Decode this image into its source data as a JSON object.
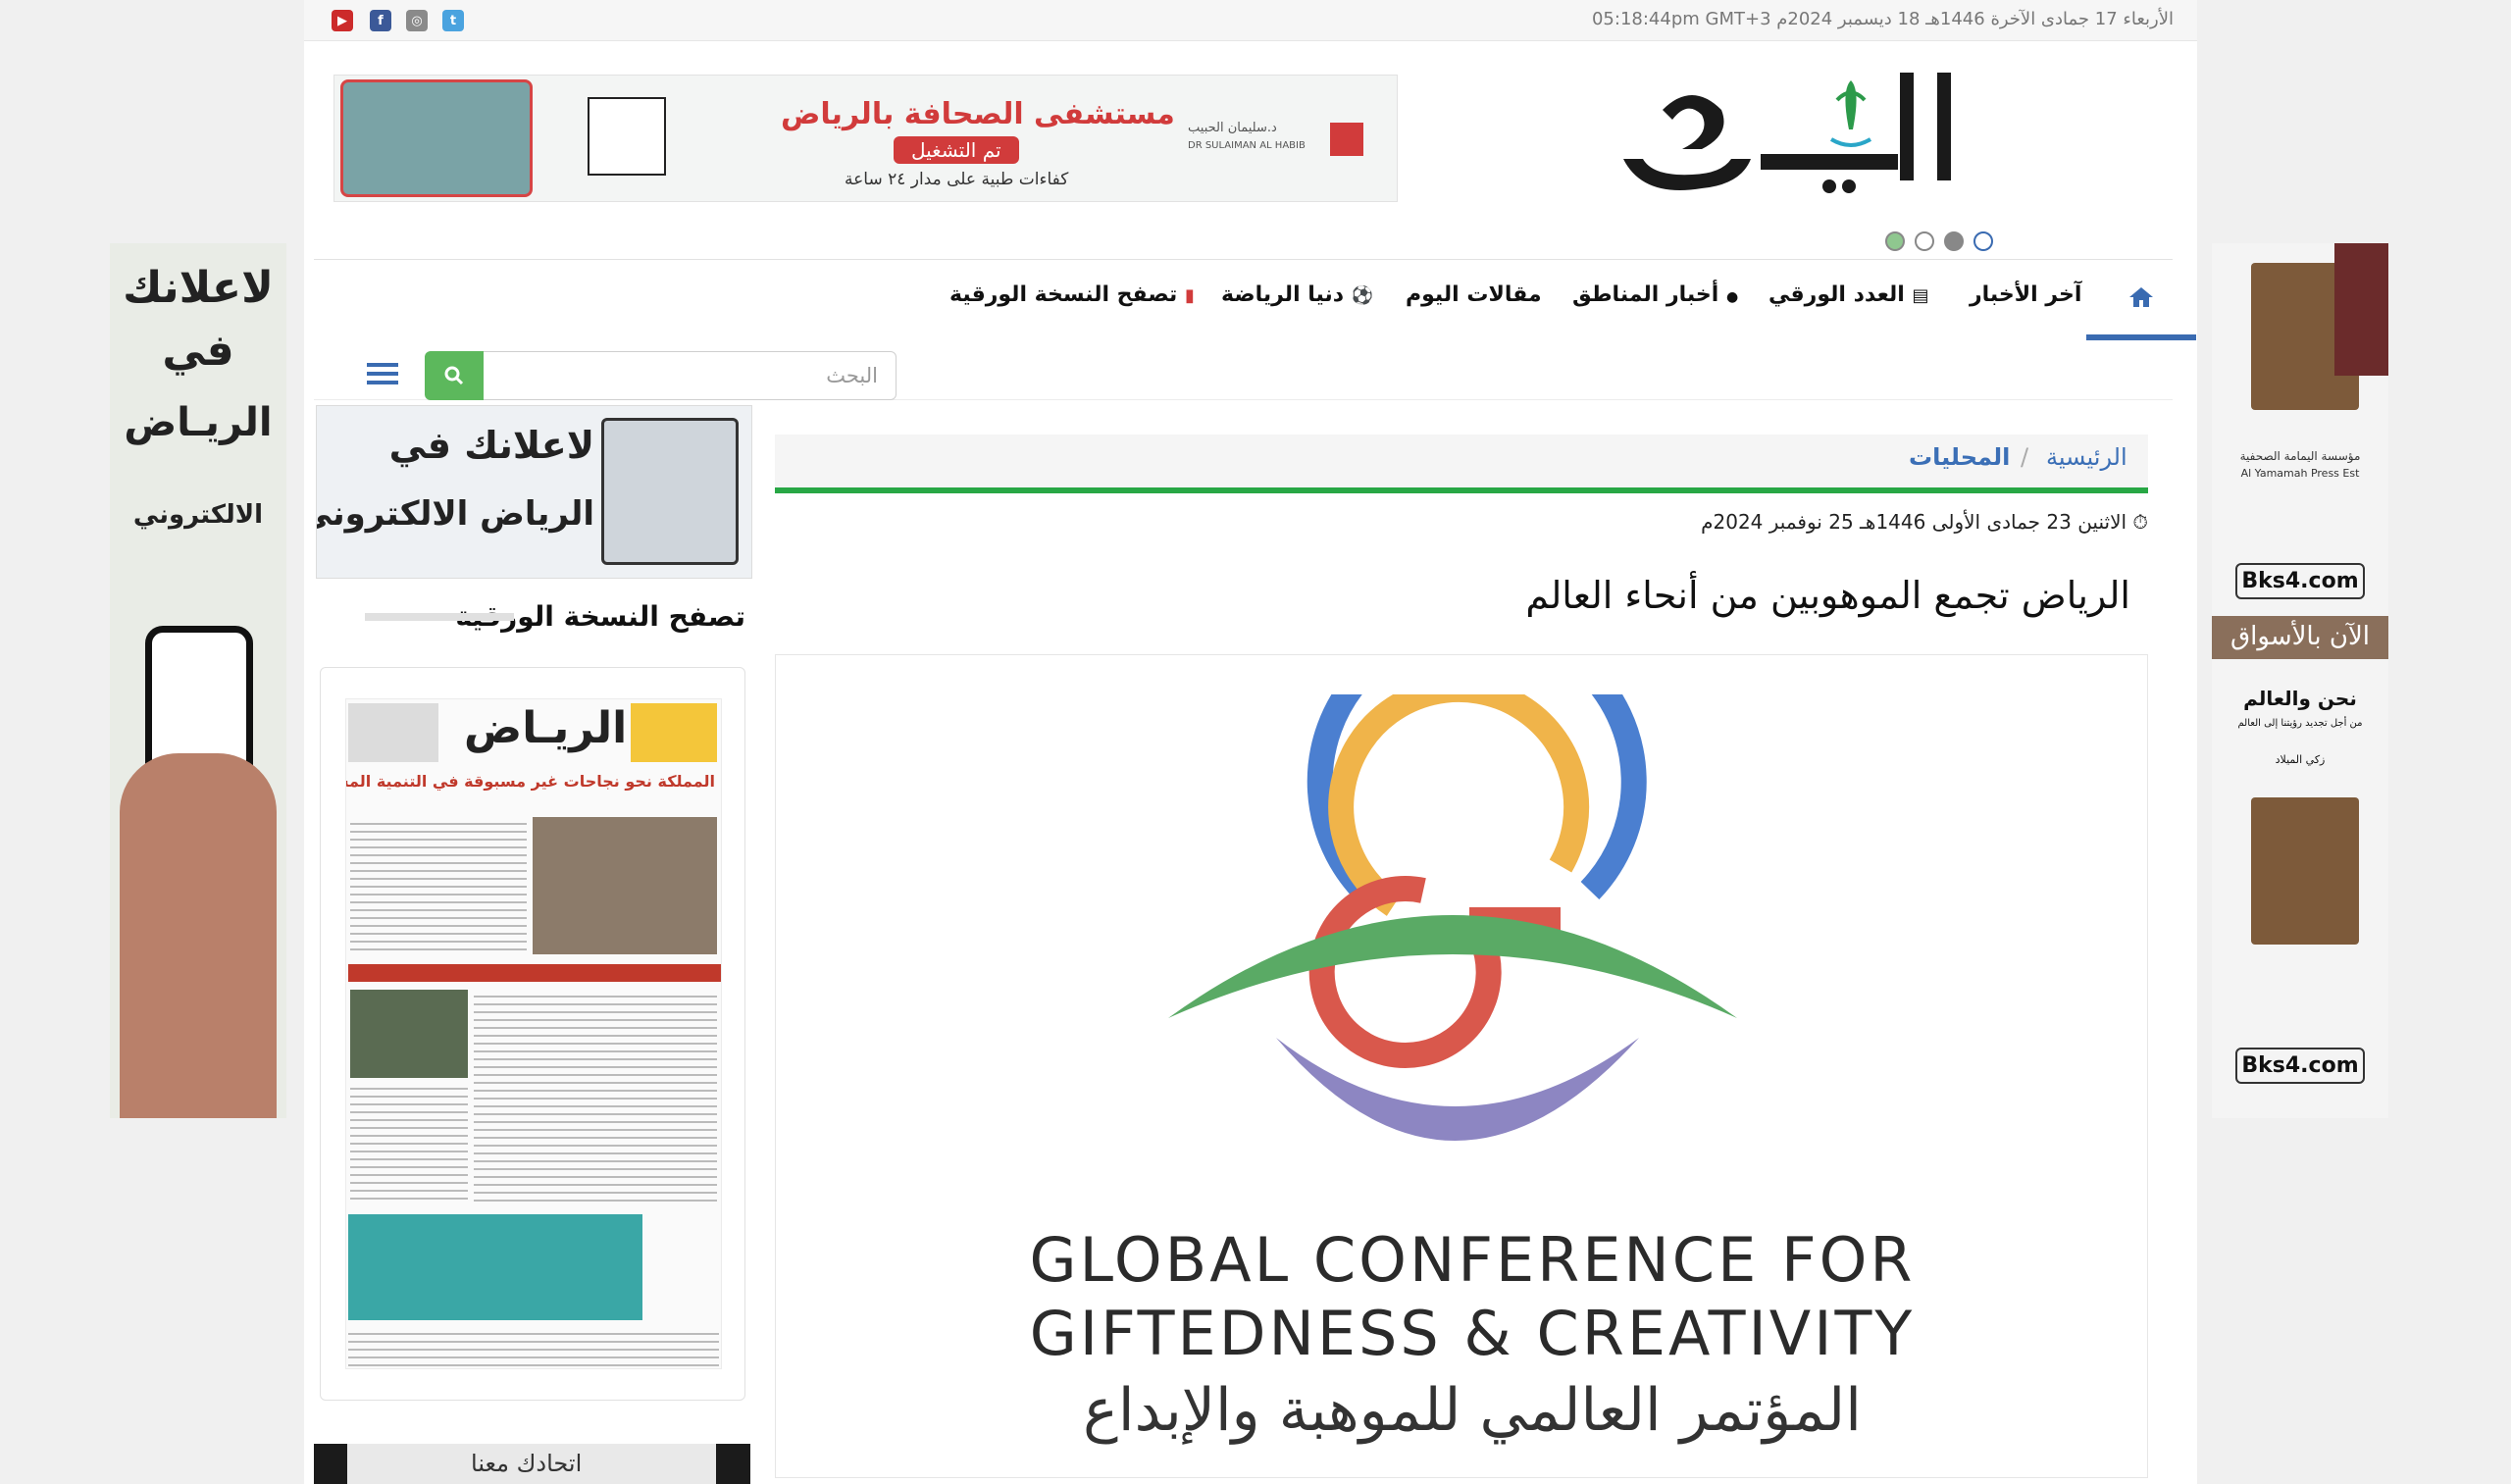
{
  "topbar": {
    "date_text": "الأربعاء 17 جمادى الآخرة 1446هـ 18 ديسمبر 2024م 05:18:44pm GMT+3",
    "social": {
      "youtube": "▶",
      "facebook": "f",
      "instagram": "◎",
      "twitter": "t"
    }
  },
  "logo": {
    "text": "الريـاض"
  },
  "header_ad": {
    "headline": "مستشفى الصحافة بالرياض",
    "badge": "تم التشغيل",
    "sub": "كفاءات طبية على مدار ٢٤ ساعة",
    "brand_ar": "د.سليمان الحبيب",
    "brand_en": "DR SULAIMAN AL HABIB"
  },
  "colors": {
    "accent_blue": "#3a6bb1",
    "green": "#28a745",
    "search_green": "#5cb85c",
    "link_blue": "#3b6fb6"
  },
  "nav": {
    "items": [
      {
        "label": "آخر الأخبار",
        "icon": ""
      },
      {
        "label": "العدد الورقي",
        "icon": "▤"
      },
      {
        "label": "أخبار المناطق",
        "icon": "●"
      },
      {
        "label": "مقالات اليوم",
        "icon": ""
      },
      {
        "label": "دنيا الرياضة",
        "icon": "⚽"
      },
      {
        "label": "تصفح النسخة الورقية",
        "icon": "▮"
      }
    ]
  },
  "search": {
    "placeholder": "البحث"
  },
  "breadcrumb": {
    "home": "الرئيسية",
    "sep": "/",
    "current": "المحليات"
  },
  "article": {
    "date": "الاثنين 23 جمادى الأولى 1446هـ 25 نوفمبر 2024م",
    "headline": "الرياض تجمع الموهوبين من أنحاء العالم",
    "hero": {
      "line1": "GLOBAL CONFERENCE FOR",
      "line2": "GIFTEDNESS & CREATIVITY",
      "line3": "المؤتمر العالمي للموهبة والإبداع"
    }
  },
  "sidebar": {
    "ad_text_1": "لاعلانك في",
    "ad_text_2": "الرياض الالكتروني",
    "paper_title": "تصفح النسخة الورقية",
    "paper_headline": "المملكة نحو نجاحات غير مسبوقة في التنمية المستدامة",
    "paper_masthead": "الريـاض",
    "bottom_ad": "اتحادك معنا"
  },
  "sky_left": {
    "l1": "لاعلانك",
    "l2": "في",
    "l3": "الريـاض",
    "l4": "الالكتروني"
  },
  "sky_right": {
    "brand": "Bks4.com",
    "markets": "الآن بالأسواق",
    "book_title": "نحن والعالم",
    "book_sub": "من أجل تجديد رؤيتنا إلى العالم",
    "author": "زكي الميلاد",
    "publisher": "مؤسسة اليمامة الصحفية",
    "publisher_en": "Al Yamamah Press Est"
  }
}
